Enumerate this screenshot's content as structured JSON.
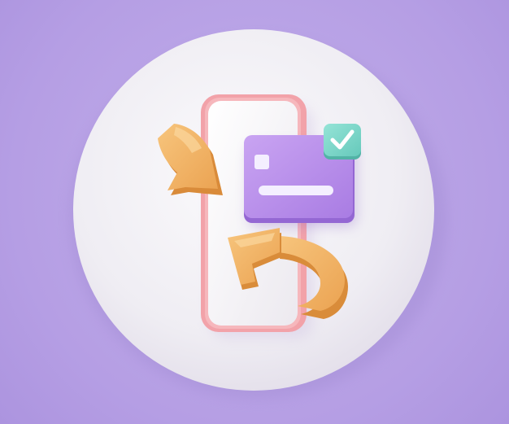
{
  "illustration": {
    "subject": "",
    "icons": [
      "phone-icon",
      "credit-card-icon",
      "check-icon",
      "refresh-arrow-icon"
    ],
    "colors": {
      "background": "#b9a3e6",
      "disc": "#f1eff5",
      "phone_frame": "#f3a6ac",
      "phone_screen": "#f7f5f8",
      "card": "#b98ee9",
      "card_edge": "#9a6fd6",
      "badge": "#7fd9cc",
      "arrow": "#f2b163",
      "arrow_shadow": "#d98c3a"
    }
  }
}
